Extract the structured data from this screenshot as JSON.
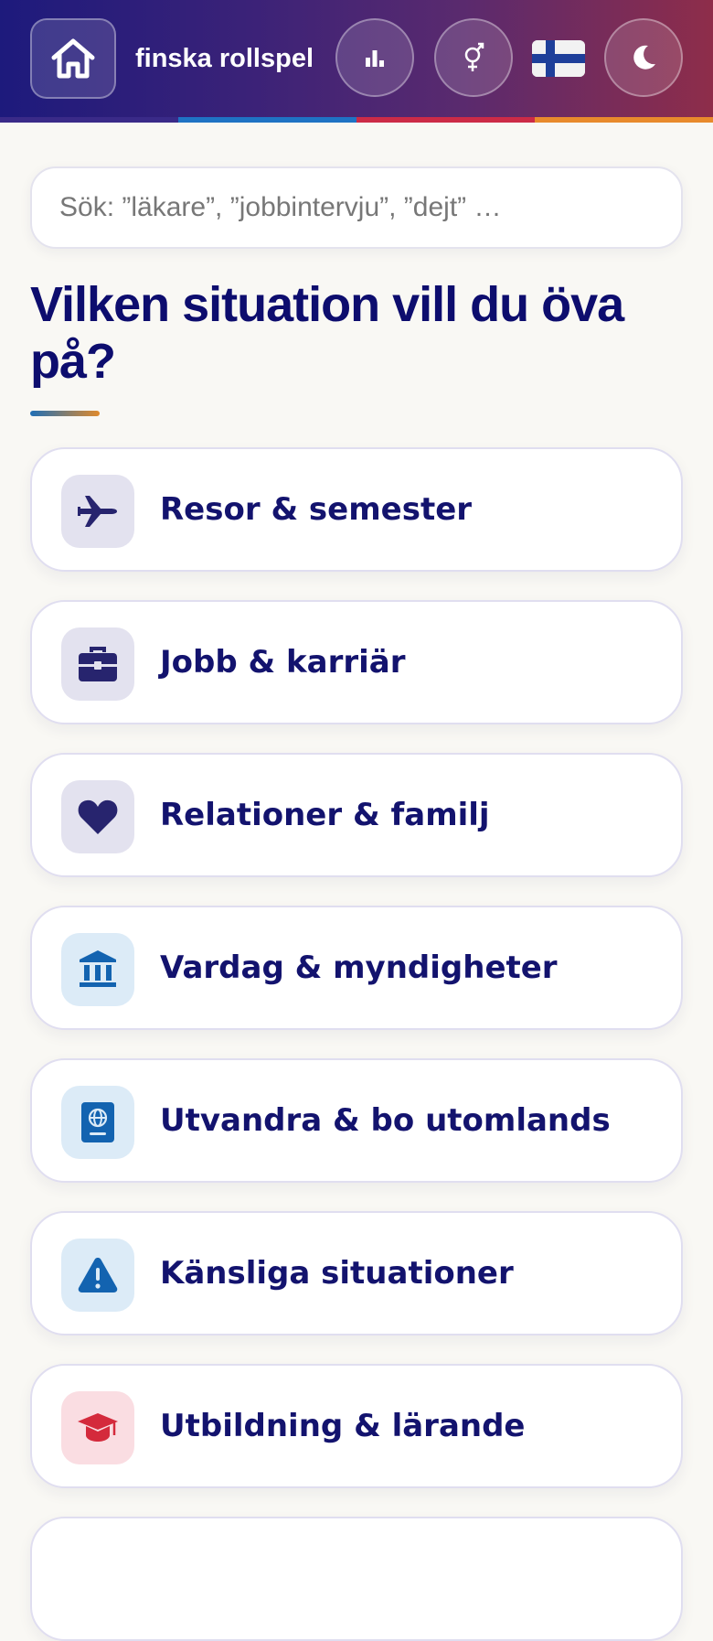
{
  "header": {
    "title": "finska rollspel",
    "buttons": {
      "home": "home-icon",
      "stats": "bar-chart-icon",
      "gender": "gender-icon",
      "language": "finland-flag-icon",
      "theme": "moon-icon"
    },
    "stripe_colors": [
      "#3a2a88",
      "#1f73c4",
      "#cc2b47",
      "#e88a2c"
    ]
  },
  "search": {
    "placeholder": "Sök: ”läkare”, ”jobbintervju”, ”dejt” …"
  },
  "main": {
    "heading": "Vilken situation vill du öva på?",
    "categories": [
      {
        "label": "Resor & semester",
        "icon": "airplane-icon"
      },
      {
        "label": "Jobb & karriär",
        "icon": "briefcase-icon"
      },
      {
        "label": "Relationer & familj",
        "icon": "heart-icon"
      },
      {
        "label": "Vardag & myndigheter",
        "icon": "bank-building-icon"
      },
      {
        "label": "Utvandra & bo utomlands",
        "icon": "passport-icon"
      },
      {
        "label": "Känsliga situationer",
        "icon": "warning-icon"
      },
      {
        "label": "Utbildning & lärande",
        "icon": "graduation-cap-icon"
      }
    ]
  },
  "colors": {
    "heading": "#0d0d6e",
    "purple_tile": "#e3e2ef",
    "purple_icon": "#27246e",
    "blue_tile": "#dcebf7",
    "blue_icon": "#1363b0",
    "red_tile": "#fadde2",
    "red_icon": "#d42a3c"
  }
}
